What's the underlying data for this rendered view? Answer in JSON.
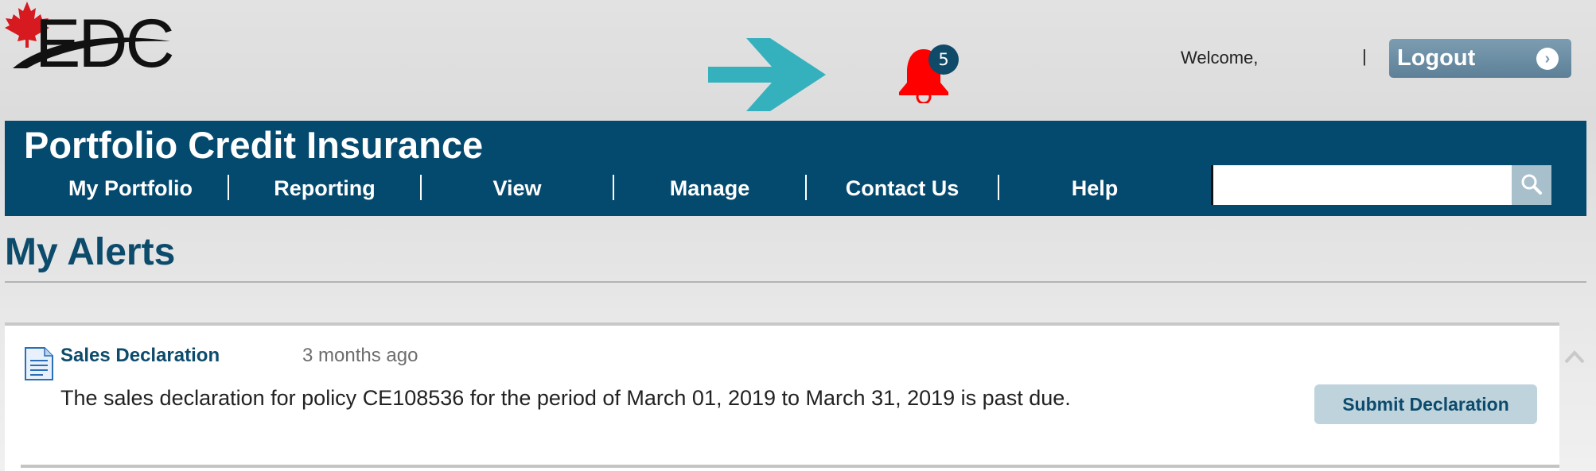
{
  "brand": {
    "logo_text": "EDC"
  },
  "header": {
    "notifications_count": "5",
    "welcome_label": "Welcome,",
    "separator": "|",
    "logout_label": "Logout",
    "logout_icon": "chevron-right-icon"
  },
  "navbar": {
    "app_title": "Portfolio Credit Insurance",
    "items": [
      {
        "label": "My Portfolio"
      },
      {
        "label": "Reporting"
      },
      {
        "label": "View"
      },
      {
        "label": "Manage"
      },
      {
        "label": "Contact Us"
      },
      {
        "label": "Help"
      }
    ],
    "search": {
      "value": "",
      "icon": "search-icon"
    }
  },
  "page": {
    "title": "My Alerts"
  },
  "alerts": [
    {
      "type": "Sales Declaration",
      "time": "3 months ago",
      "message": "The sales declaration for policy CE108536 for the period of March 01, 2019 to March 31, 2019 is past due.",
      "action_label": "Submit Declaration",
      "icon": "document-icon"
    }
  ],
  "colors": {
    "brand_blue": "#044a6e",
    "title_blue": "#0c4b6c",
    "bell_red": "#ff0000",
    "arrow_teal": "#35b0bd",
    "logout_bg": "#6b8da4",
    "submit_bg": "#bfd3dd"
  }
}
